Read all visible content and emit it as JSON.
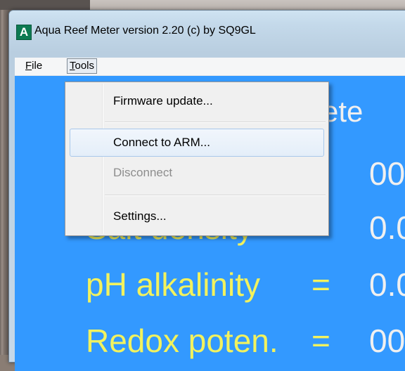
{
  "window": {
    "title": "Aqua Reef Meter version 2.20 (c) by SQ9GL",
    "icon_letter": "A",
    "icon_color": "#0d7a52"
  },
  "menubar": {
    "file": {
      "prefix": "",
      "underlined": "F",
      "rest": "ile"
    },
    "tools": {
      "prefix": "",
      "underlined": "T",
      "rest": "ools"
    }
  },
  "tools_menu": {
    "items": [
      {
        "label": "Firmware update...",
        "enabled": true,
        "highlighted": false
      },
      {
        "label": "Connect to ARM...",
        "enabled": true,
        "highlighted": true
      },
      {
        "label": "Disconnect",
        "enabled": false,
        "highlighted": false
      },
      {
        "label": "Settings...",
        "enabled": true,
        "highlighted": false
      }
    ]
  },
  "display": {
    "background": "#3399ff",
    "label_color": "#f2f25e",
    "value_color": "#f0f0f0",
    "header_partial": "mete",
    "rows": [
      {
        "label": "",
        "eq": "=",
        "value": "00"
      },
      {
        "label": "Salt density",
        "eq": "=",
        "value": "0.0"
      },
      {
        "label": "pH alkalinity",
        "eq": "=",
        "value": "0.0"
      },
      {
        "label": "Redox poten.",
        "eq": "=",
        "value": "00"
      }
    ]
  }
}
